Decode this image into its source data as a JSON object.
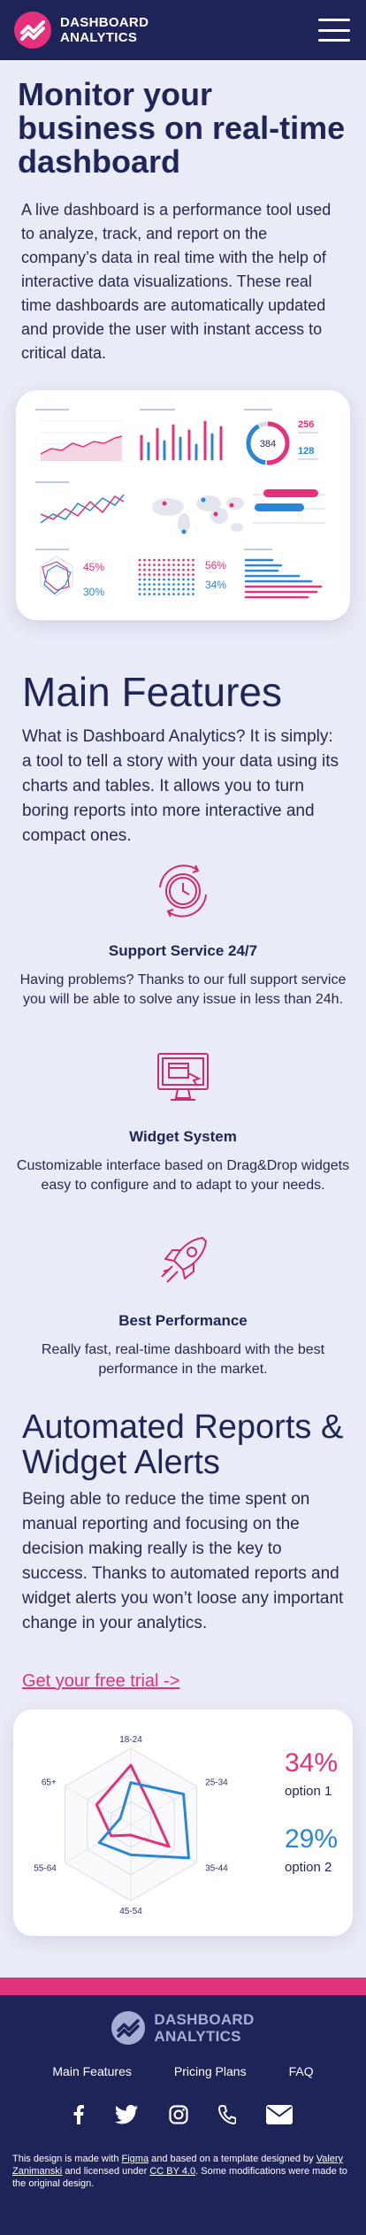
{
  "header": {
    "brand_line1": "DASHBOARD",
    "brand_line2": "ANALYTICS",
    "menu_icon": "hamburger-menu-icon"
  },
  "hero": {
    "title": "Monitor your business on real-time dashboard",
    "description": "A live dashboard is a performance tool used to analyze, track, and report on the company’s data in real time with the help of interactive data visualizations. These real time dashboards are automatically updated and provide the user with instant access to critical data."
  },
  "dashboard_preview": {
    "donut_value": "384",
    "metric1_value": "256",
    "metric2_value": "128",
    "percent1": "45%",
    "percent2": "30%",
    "percent3": "56%",
    "percent4": "34%"
  },
  "features": {
    "title": "Main Features",
    "lead": "What is Dashboard Analytics? It is simply: a tool to tell a story with your data using its charts and tables. It allows you to turn boring reports into more interactive and compact ones.",
    "items": [
      {
        "icon": "clock-refresh-icon",
        "title": "Support Service 24/7",
        "text": "Having problems? Thanks to our full support service you will be able to solve any issue in less than 24h."
      },
      {
        "icon": "monitor-widget-icon",
        "title": "Widget System",
        "text": "Customizable interface based on Drag&Drop widgets easy to configure and to adapt to your needs."
      },
      {
        "icon": "rocket-icon",
        "title": "Best Performance",
        "text": "Really fast, real-time dashboard with the best performance in the market."
      }
    ]
  },
  "reports": {
    "title": "Automated Reports & Widget Alerts",
    "lead": "Being able to reduce the time spent on manual reporting and focusing on the decision making really is the key to success. Thanks to automated reports and widget alerts you won’t loose any important change in your analytics.",
    "cta": "Get your free trial ->"
  },
  "chart_data": {
    "type": "radar",
    "categories": [
      "18-24",
      "25-34",
      "35-44",
      "45-54",
      "55-64",
      "65+"
    ],
    "series": [
      {
        "name": "option 1",
        "color": "#e5317b",
        "values": [
          0.78,
          0.34,
          0.58,
          0.14,
          0.3,
          0.52
        ]
      },
      {
        "name": "option 2",
        "color": "#2a86d6",
        "values": [
          0.55,
          0.8,
          0.88,
          0.4,
          0.48,
          0.16
        ]
      }
    ],
    "stats": [
      {
        "value": "34%",
        "label": "option 1",
        "color": "#e5317b"
      },
      {
        "value": "29%",
        "label": "option 2",
        "color": "#2a86d6"
      }
    ]
  },
  "footer": {
    "brand_line1": "DASHBOARD",
    "brand_line2": "ANALYTICS",
    "nav": [
      "Main Features",
      "Pricing Plans",
      "FAQ"
    ],
    "socials": [
      "facebook-icon",
      "twitter-icon",
      "instagram-icon",
      "phone-icon",
      "mail-icon"
    ],
    "credit_pre": "This design is made with",
    "credit_figma": "Figma",
    "credit_mid": "and based on a template designed by",
    "credit_author": "Valery Zanimanski",
    "credit_licensed": "and licensed under",
    "credit_license": "CC BY 4.0",
    "credit_post": ". Some modifications were made to the original design."
  },
  "colors": {
    "navy": "#1e2358",
    "pink": "#e5317b",
    "blue": "#2a86d6",
    "background": "#e9ebf7"
  }
}
